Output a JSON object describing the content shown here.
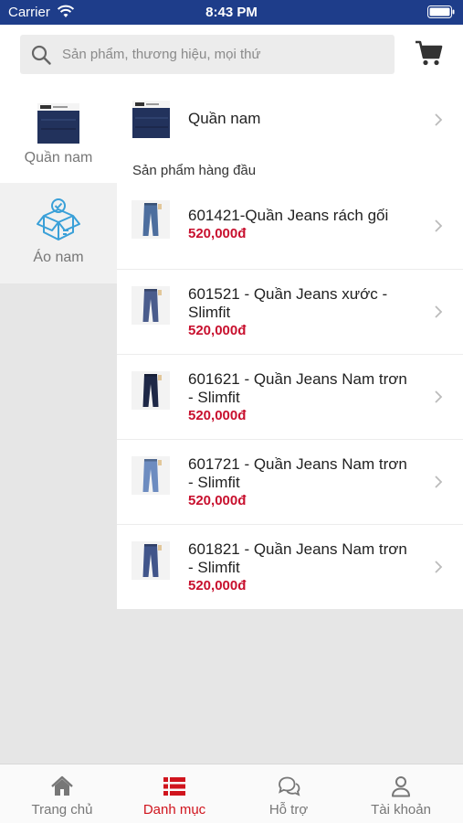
{
  "status_bar": {
    "carrier": "Carrier",
    "time": "8:43 PM"
  },
  "search": {
    "placeholder": "Sản phẩm, thương hiệu, mọi thứ"
  },
  "sidebar": {
    "items": [
      {
        "label": "Quần nam",
        "selected": true
      },
      {
        "label": "Áo nam",
        "selected": false
      }
    ]
  },
  "main": {
    "category_title": "Quần nam",
    "section_title": "Sản phẩm hàng đầu",
    "products": [
      {
        "name_line1": "601421-Quần Jeans rách gối",
        "name_line2": "",
        "price": "520,000đ",
        "jeans_color": "#4d6e9e"
      },
      {
        "name_line1": "601521 - Quần Jeans xước -",
        "name_line2": "Slimfit",
        "price": "520,000đ",
        "jeans_color": "#4a5c8c"
      },
      {
        "name_line1": "601621 - Quần Jeans Nam trơn",
        "name_line2": "- Slimfit",
        "price": "520,000đ",
        "jeans_color": "#1e2847"
      },
      {
        "name_line1": "601721 - Quần Jeans Nam trơn",
        "name_line2": "- Slimfit",
        "price": "520,000đ",
        "jeans_color": "#6d8cc0"
      },
      {
        "name_line1": "601821 - Quần Jeans Nam trơn",
        "name_line2": "- Slimfit",
        "price": "520,000đ",
        "jeans_color": "#41558a"
      }
    ]
  },
  "tabs": [
    {
      "label": "Trang chủ",
      "icon": "home-icon",
      "active": false
    },
    {
      "label": "Danh mục",
      "icon": "list-icon",
      "active": true
    },
    {
      "label": "Hỗ trợ",
      "icon": "chat-icon",
      "active": false
    },
    {
      "label": "Tài khoản",
      "icon": "user-icon",
      "active": false
    }
  ],
  "colors": {
    "status_bar": "#1e3d8a",
    "accent": "#d0141d",
    "price": "#c8102e",
    "box_icon": "#3aa0d8"
  }
}
